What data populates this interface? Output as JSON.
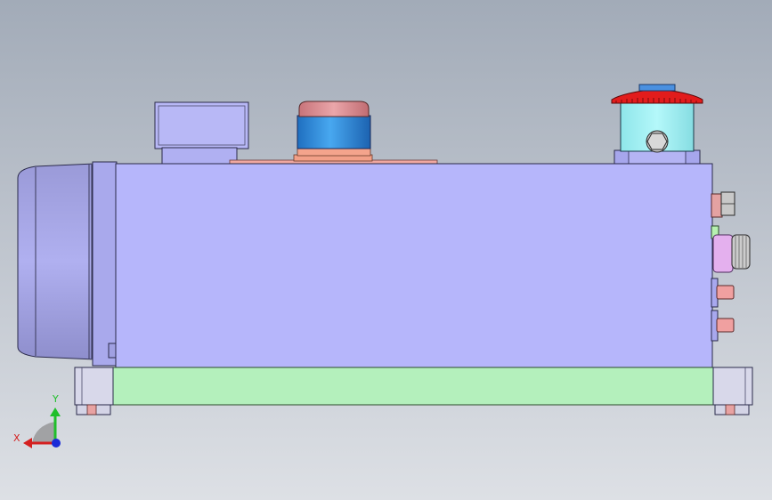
{
  "viewport": {
    "background_top": "#a4adb9",
    "background_bottom": "#dcdfe4"
  },
  "triad": {
    "x_label": "X",
    "y_label": "Y",
    "x_color": "#d42020",
    "y_color": "#1fbf2a",
    "z_color": "#1a2bd8"
  },
  "colors": {
    "tank": "#b6b6fb",
    "motor": "#a6a6ea",
    "base": "#b4f0bc",
    "feet": "#d9d9ea",
    "cap_red": "#e41c1c",
    "filter_cyan": "#9cf2f4",
    "breather_blue": "#2f8fe0",
    "breather_pink": "#e0999e",
    "plate_salmon": "#efa29a",
    "port_pink": "#e4a4a4",
    "gauge_violet": "#e6b0f0",
    "port_green": "#b6f0b0"
  }
}
